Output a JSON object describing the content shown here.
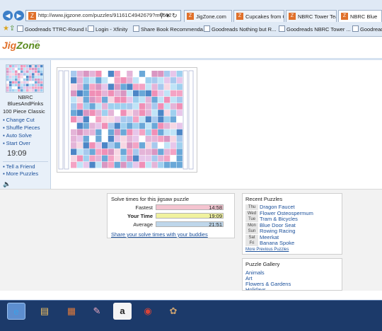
{
  "browser": {
    "url": "http://www.jigzone.com/puzzles/91161C4942679?m=502",
    "tabs": [
      {
        "label": "JigZone.com",
        "active": false
      },
      {
        "label": "Cupcakes from Captain Cupca...",
        "active": false
      },
      {
        "label": "NBRC Tower Team Challenge: ...",
        "active": false
      },
      {
        "label": "NBRC Blue",
        "active": true
      }
    ],
    "favorites": [
      "Goodreads TTRC-Round I...",
      "Login - Xfinity",
      "Share Book Recommenda...",
      "Goodreads Nothing but R...",
      "Goodreads NBRC Tower ...",
      "Goodreads"
    ]
  },
  "site": {
    "logo_jig": "Jig",
    "logo_zone": "Zone",
    "logo_sub": ".com"
  },
  "left": {
    "puzzle_name": "NBRC\nBluesAndPinks",
    "piece_info": "100 Piece Classic",
    "links": [
      "Change Cut",
      "Shuffle Pieces",
      "Auto Solve",
      "Start Over"
    ],
    "timer": "19:09",
    "links2": [
      "Tell a Friend",
      "More Puzzles"
    ]
  },
  "solve": {
    "title": "Solve times for this jigsaw puzzle",
    "rows": [
      {
        "label": "Fastest",
        "value": "14:58",
        "color": "#f4c4d0",
        "bold": false
      },
      {
        "label": "Your Time",
        "value": "19:09",
        "color": "#f0f29e",
        "bold": true
      },
      {
        "label": "Average",
        "value": "21:51",
        "color": "#bed6ea",
        "bold": false
      }
    ],
    "share": "Share your solve times with your buddies"
  },
  "recent": {
    "title": "Recent Puzzles",
    "items": [
      {
        "day": "Thu",
        "name": "Dragon Faucet"
      },
      {
        "day": "Wed",
        "name": "Flower Osteospermum"
      },
      {
        "day": "Tue",
        "name": "Tram & Bicycles"
      },
      {
        "day": "Mon",
        "name": "Blue Door Seat"
      },
      {
        "day": "Sun",
        "name": "Rowing Racing"
      },
      {
        "day": "Sat",
        "name": "Meerkat"
      },
      {
        "day": "Fri",
        "name": "Banana Spoke"
      }
    ],
    "more": "More Previous Puzzles"
  },
  "gallery": {
    "title": "Puzzle Gallery",
    "items": [
      "Animals",
      "Art",
      "Flowers & Gardens",
      "Holidays"
    ]
  },
  "taskbar": [
    {
      "icon": "ie-icon",
      "glyph": "e",
      "active": true,
      "color": "#3aa0e8"
    },
    {
      "icon": "folder-icon",
      "glyph": "▤",
      "active": false,
      "color": "#f0c060"
    },
    {
      "icon": "media-icon",
      "glyph": "▦",
      "active": false,
      "color": "#e07a3a"
    },
    {
      "icon": "paint-icon",
      "glyph": "✎",
      "active": false,
      "color": "#e8a8c0"
    },
    {
      "icon": "amazon-icon",
      "glyph": "a",
      "active": false,
      "color": "#222222"
    },
    {
      "icon": "chrome-icon",
      "glyph": "◉",
      "active": false,
      "color": "#db4437"
    },
    {
      "icon": "palette-icon",
      "glyph": "✿",
      "active": false,
      "color": "#c8a070"
    }
  ]
}
